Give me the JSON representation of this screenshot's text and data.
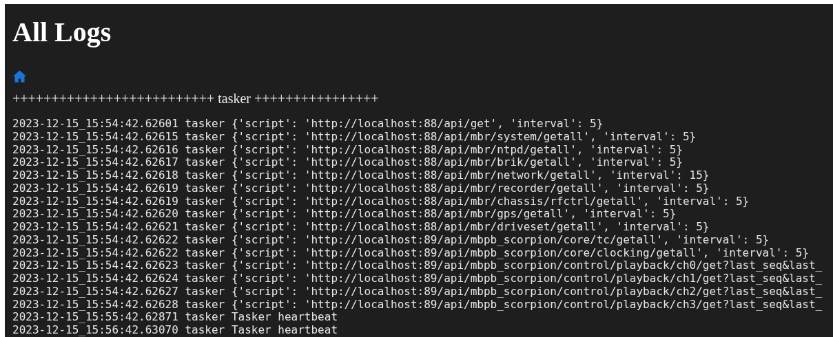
{
  "page": {
    "title": "All Logs"
  },
  "separator": "++++++++++++++++++++++++++ tasker ++++++++++++++++",
  "log_lines": [
    {
      "text": "2023-12-15_15:54:42.62601 tasker {'script': 'http://localhost:88/api/get', 'interval': 5}"
    },
    {
      "text": "2023-12-15_15:54:42.62615 tasker {'script': 'http://localhost:88/api/mbr/system/getall', 'interval': 5}"
    },
    {
      "text": "2023-12-15_15:54:42.62616 tasker {'script': 'http://localhost:88/api/mbr/ntpd/getall', 'interval': 5}"
    },
    {
      "text": "2023-12-15_15:54:42.62617 tasker {'script': 'http://localhost:88/api/mbr/brik/getall', 'interval': 5}"
    },
    {
      "text": "2023-12-15_15:54:42.62618 tasker {'script': 'http://localhost:88/api/mbr/network/getall', 'interval': 15}"
    },
    {
      "text": "2023-12-15_15:54:42.62619 tasker {'script': 'http://localhost:88/api/mbr/recorder/getall', 'interval': 5}"
    },
    {
      "text": "2023-12-15_15:54:42.62619 tasker {'script': 'http://localhost:88/api/mbr/chassis/rfctrl/getall', 'interval': 5}"
    },
    {
      "text": "2023-12-15_15:54:42.62620 tasker {'script': 'http://localhost:88/api/mbr/gps/getall', 'interval': 5}"
    },
    {
      "text": "2023-12-15_15:54:42.62621 tasker {'script': 'http://localhost:88/api/mbr/driveset/getall', 'interval': 5}"
    },
    {
      "text": "2023-12-15_15:54:42.62622 tasker {'script': 'http://localhost:89/api/mbpb_scorpion/core/tc/getall', 'interval': 5}"
    },
    {
      "text": "2023-12-15_15:54:42.62622 tasker {'script': 'http://localhost:89/api/mbpb_scorpion/core/clocking/getall', 'interval': 5}"
    },
    {
      "text": "2023-12-15_15:54:42.62623 tasker {'script': 'http://localhost:89/api/mbpb_scorpion/control/playback/ch0/get?last_seq&last_"
    },
    {
      "text": "2023-12-15_15:54:42.62624 tasker {'script': 'http://localhost:89/api/mbpb_scorpion/control/playback/ch1/get?last_seq&last_"
    },
    {
      "text": "2023-12-15_15:54:42.62627 tasker {'script': 'http://localhost:89/api/mbpb_scorpion/control/playback/ch2/get?last_seq&last_"
    },
    {
      "text": "2023-12-15_15:54:42.62628 tasker {'script': 'http://localhost:89/api/mbpb_scorpion/control/playback/ch3/get?last_seq&last_"
    },
    {
      "text": "2023-12-15_15:55:42.62871 tasker Tasker heartbeat"
    },
    {
      "text": "2023-12-15_15:56:42.63070 tasker Tasker heartbeat"
    }
  ]
}
